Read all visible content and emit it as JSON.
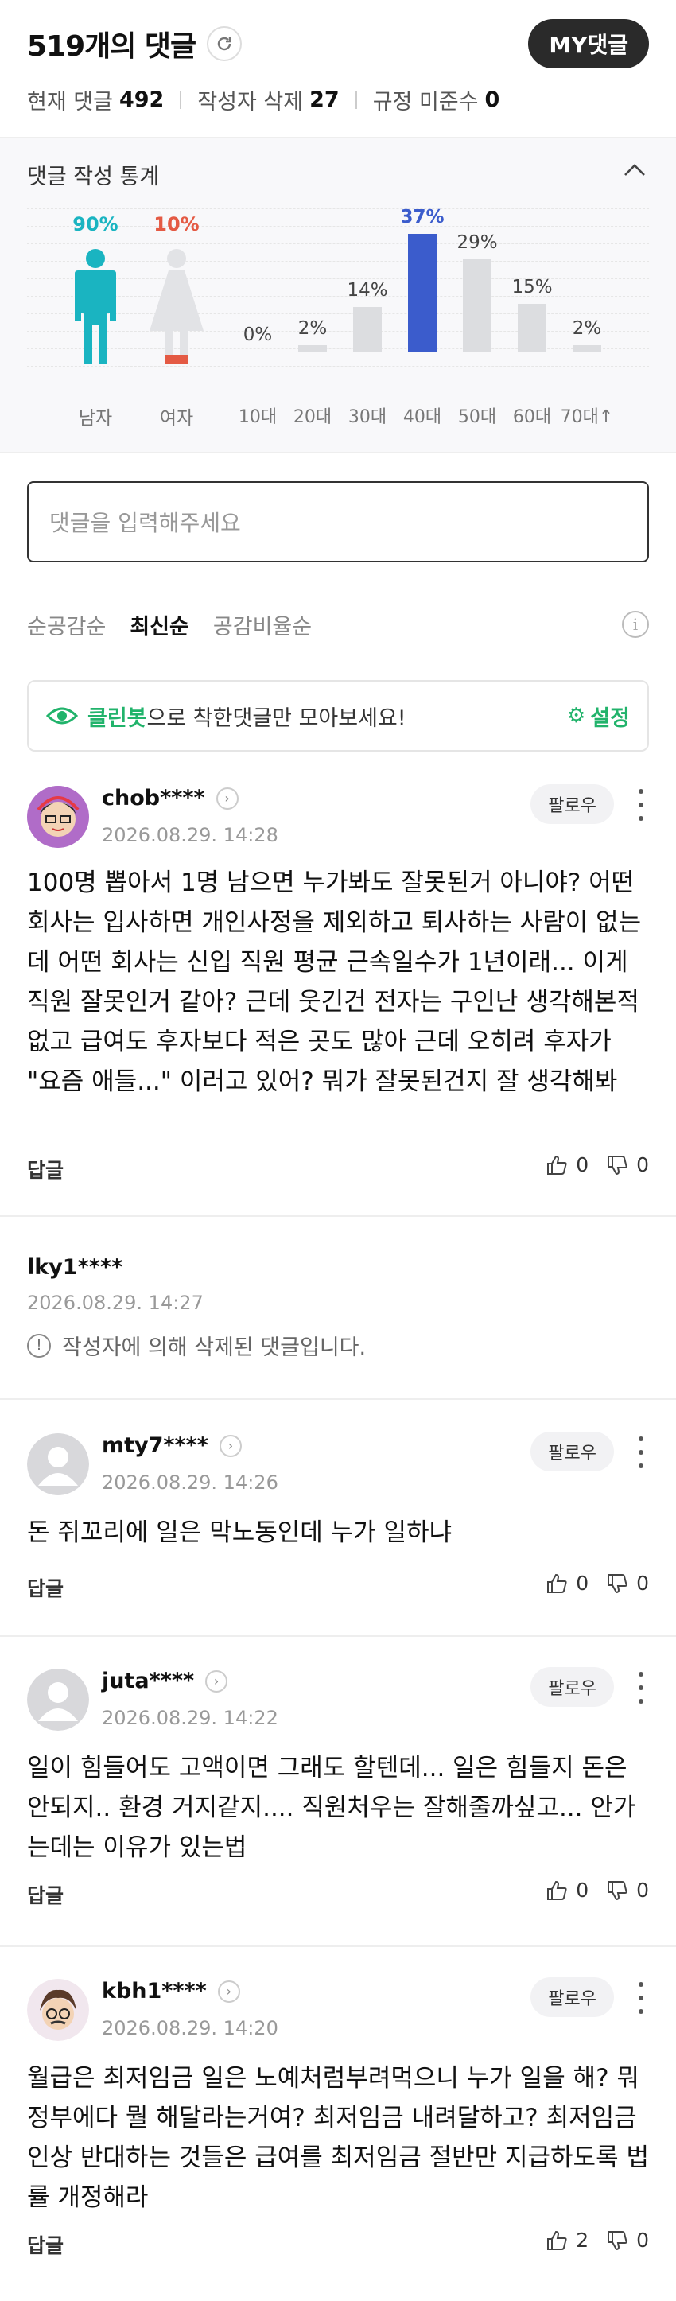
{
  "header": {
    "title": "519개의 댓글",
    "my_button": "MY댓글",
    "stats": [
      {
        "label": "현재 댓글",
        "value": "492"
      },
      {
        "label": "작성자 삭제",
        "value": "27"
      },
      {
        "label": "규정 미준수",
        "value": "0"
      }
    ]
  },
  "panel": {
    "title": "댓글 작성 통계",
    "gender": [
      {
        "label": "남자",
        "pct": "90%",
        "value": 90,
        "color": "#1ab4c1"
      },
      {
        "label": "여자",
        "pct": "10%",
        "value": 10,
        "color": "#e45a44"
      }
    ],
    "ages": [
      {
        "label": "10대",
        "pct": "0%",
        "value": 0
      },
      {
        "label": "20대",
        "pct": "2%",
        "value": 2
      },
      {
        "label": "30대",
        "pct": "14%",
        "value": 14
      },
      {
        "label": "40대",
        "pct": "37%",
        "value": 37
      },
      {
        "label": "50대",
        "pct": "29%",
        "value": 29
      },
      {
        "label": "60대",
        "pct": "15%",
        "value": 15
      },
      {
        "label": "70대↑",
        "pct": "2%",
        "value": 2
      }
    ]
  },
  "input": {
    "placeholder": "댓글을 입력해주세요"
  },
  "tabs": [
    {
      "label": "순공감순",
      "active": false
    },
    {
      "label": "최신순",
      "active": true
    },
    {
      "label": "공감비율순",
      "active": false
    }
  ],
  "cleanbot": {
    "brand": "클린봇",
    "text": "으로 착한댓글만 모아보세요!",
    "settings": "설정"
  },
  "comments": [
    {
      "user": "chob****",
      "date": "2026.08.29. 14:28",
      "follow": "팔로우",
      "text": "100명 뽑아서 1명 남으면 누가봐도 잘못된거 아니야? 어떤 회사는 입사하면 개인사정을 제외하고 퇴사하는 사람이 없는데 어떤 회사는 신입 직원 평균 근속일수가 1년이래... 이게 직원 잘못인거 같아? 근데 웃긴건 전자는 구인난 생각해본적 없고 급여도 후자보다 적은 곳도 많아 근데 오히려 후자가 \"요즘 애들...\" 이러고 있어? 뭐가 잘못된건지 잘 생각해봐",
      "reply": "답글",
      "likes": "0",
      "dislikes": "0"
    },
    {
      "user": "lky1****",
      "date": "2026.08.29. 14:27",
      "deleted_text": "작성자에 의해 삭제된 댓글입니다."
    },
    {
      "user": "mty7****",
      "date": "2026.08.29. 14:26",
      "follow": "팔로우",
      "text": "돈 쥐꼬리에 일은 막노동인데 누가 일하냐",
      "reply": "답글",
      "likes": "0",
      "dislikes": "0"
    },
    {
      "user": "juta****",
      "date": "2026.08.29. 14:22",
      "follow": "팔로우",
      "text": "일이 힘들어도 고액이면 그래도 할텐데... 일은 힘들지 돈은 안되지.. 환경 거지같지.... 직원처우는 잘해줄까싶고... 안가는데는 이유가 있는법",
      "reply": "답글",
      "likes": "0",
      "dislikes": "0"
    },
    {
      "user": "kbh1****",
      "date": "2026.08.29. 14:20",
      "follow": "팔로우",
      "text": "월급은 최저임금 일은 노예처럼부려먹으니 누가 일을 해? 뭐 정부에다 뭘 해달라는거여? 최저임금 내려달하고? 최저임금인상 반대하는 것들은 급여를 최저임금 절반만 지급하도록 법률 개정해라",
      "reply": "답글",
      "likes": "2",
      "dislikes": "0"
    }
  ]
}
